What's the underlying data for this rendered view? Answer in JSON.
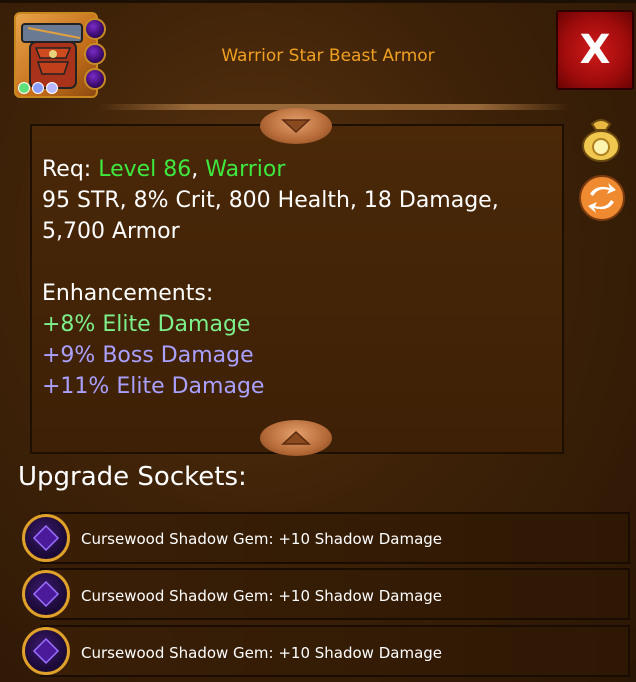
{
  "item": {
    "title": "Warrior Star Beast Armor",
    "icon": "chest-armor-icon",
    "gem_slots": 3,
    "tiny_dots": [
      "#5fe07a",
      "#8a9cff",
      "#b8b8ff"
    ]
  },
  "close_label": "X",
  "description": {
    "req_prefix": "Req: ",
    "req_level": "Level 86",
    "req_sep": ", ",
    "req_class": "Warrior",
    "stats_line1": "95 STR, 8% Crit, 800 Health, 18 Damage,",
    "stats_line2": "5,700 Armor",
    "enhancements_title": "Enhancements:",
    "enhancements": [
      {
        "text": "+8% Elite Damage",
        "color": "#7cf08a"
      },
      {
        "text": "+9% Boss Damage",
        "color": "#a9a0ff"
      },
      {
        "text": "+11% Elite Damage",
        "color": "#a9a0ff"
      }
    ]
  },
  "sockets": {
    "title": "Upgrade Sockets:",
    "items": [
      {
        "label": "Cursewood Shadow Gem: +10 Shadow Damage",
        "icon": "purple-gem-icon"
      },
      {
        "label": "Cursewood Shadow Gem: +10 Shadow Damage",
        "icon": "purple-gem-icon"
      },
      {
        "label": "Cursewood Shadow Gem: +10 Shadow Damage",
        "icon": "purple-gem-icon"
      }
    ]
  },
  "side_icons": [
    "gold-bag-icon",
    "swap-icon"
  ]
}
